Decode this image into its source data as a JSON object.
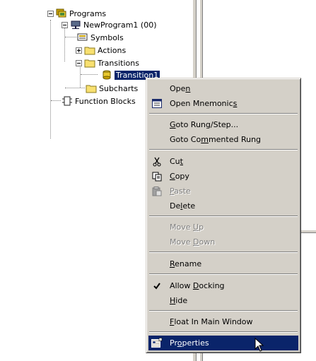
{
  "tree": {
    "items": [
      {
        "label": "Programs",
        "icon": "programs-icon",
        "expanded": true
      },
      {
        "label": "NewProgram1 (00)",
        "icon": "program-icon",
        "expanded": true
      },
      {
        "label": "Symbols",
        "icon": "symbols-icon"
      },
      {
        "label": "Actions",
        "icon": "folder-icon",
        "expanded": false
      },
      {
        "label": "Transitions",
        "icon": "folder-icon",
        "expanded": true
      },
      {
        "label": "Transition1",
        "icon": "transition-icon",
        "selected": true
      },
      {
        "label": "Subcharts",
        "icon": "folder-icon"
      },
      {
        "label": "Function Blocks",
        "icon": "function-blocks-icon"
      }
    ]
  },
  "context_menu": {
    "items": [
      {
        "pre": "Ope",
        "acc": "n",
        "post": "",
        "enabled": true
      },
      {
        "pre": "Open Mnemonic",
        "acc": "s",
        "post": "",
        "enabled": true,
        "icon": "mnemonics-icon"
      },
      {
        "pre": "",
        "acc": "G",
        "post": "oto Rung/Step...",
        "enabled": true
      },
      {
        "pre": "Goto Co",
        "acc": "m",
        "post": "mented Rung",
        "enabled": true
      },
      {
        "pre": "Cu",
        "acc": "t",
        "post": "",
        "enabled": true,
        "icon": "cut-icon"
      },
      {
        "pre": "",
        "acc": "C",
        "post": "opy",
        "enabled": true,
        "icon": "copy-icon"
      },
      {
        "pre": "",
        "acc": "P",
        "post": "aste",
        "enabled": false,
        "icon": "paste-icon"
      },
      {
        "pre": "De",
        "acc": "l",
        "post": "ete",
        "enabled": true
      },
      {
        "pre": "Move ",
        "acc": "U",
        "post": "p",
        "enabled": false
      },
      {
        "pre": "Move ",
        "acc": "D",
        "post": "own",
        "enabled": false
      },
      {
        "pre": "",
        "acc": "R",
        "post": "ename",
        "enabled": true
      },
      {
        "pre": "Allow ",
        "acc": "D",
        "post": "ocking",
        "enabled": true,
        "checked": true
      },
      {
        "pre": "",
        "acc": "H",
        "post": "ide",
        "enabled": true
      },
      {
        "pre": "",
        "acc": "F",
        "post": "loat In Main Window",
        "enabled": true
      },
      {
        "pre": "Pr",
        "acc": "o",
        "post": "perties",
        "enabled": true,
        "highlighted": true,
        "icon": "properties-icon"
      }
    ]
  },
  "colors": {
    "selection": "#0a246a",
    "menu_face": "#d4d0c8",
    "disabled_text": "#808080"
  }
}
